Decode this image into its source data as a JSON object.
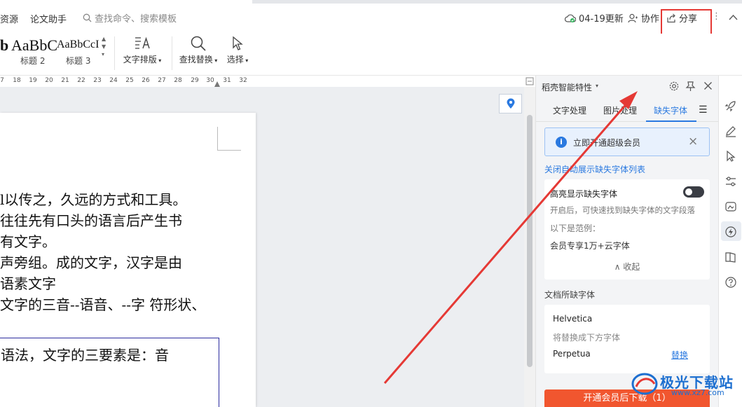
{
  "menu": {
    "items": [
      "资源",
      "论文助手"
    ],
    "search_placeholder": "查找命令、搜索模板",
    "update_label": "04-19更新",
    "collab_label": "协作",
    "share_label": "分享"
  },
  "ribbon": {
    "styles": [
      {
        "preview": "b",
        "name": ""
      },
      {
        "preview": "AaBbC",
        "name": "标题 2"
      },
      {
        "preview": "AaBbCcI",
        "name": "标题 3"
      }
    ],
    "text_layout": "文字排版",
    "find_replace": "查找替换",
    "select": "选择"
  },
  "ruler": [
    "7",
    "18",
    "19",
    "20",
    "21",
    "22",
    "23",
    "24",
    "25",
    "26",
    "27",
    "28",
    "29",
    "30",
    "31",
    "32"
  ],
  "document": {
    "lines": [
      "l以传之，久远的方式和工具。",
      "往往先有口头的语言后产生书",
      "有文字。",
      "声旁组。成的文字，汉字是由",
      "语素文字",
      "文字的三音--语音、--字  符形状、"
    ],
    "box_line": "语法，文字的三要素是：音"
  },
  "panel": {
    "title": "稻壳智能特性",
    "tabs": [
      "文字处理",
      "图片处理",
      "缺失字体"
    ],
    "active_tab": 2,
    "vip_banner": "立即开通超级会员",
    "close_link": "关闭自动展示缺失字体列表",
    "highlight": {
      "title": "高亮显示缺失字体",
      "desc": "开启后，可快速找到缺失字体的文字段落",
      "example_label": "以下是范例：",
      "example": "会员专享1万+云字体",
      "collapse": "收起"
    },
    "missing_title": "文档所缺字体",
    "missing": {
      "font": "Helvetica",
      "replace_hint": "将替换成下方字体",
      "replacement": "Perpetua",
      "replace_btn": "替换"
    },
    "download_btn": "开通会员后下载（1）"
  },
  "watermark": {
    "name": "极光下载站",
    "url": "www.xz7.com"
  },
  "colors": {
    "accent": "#2a79e0",
    "annotation": "#e53935",
    "download": "#f1562f"
  }
}
